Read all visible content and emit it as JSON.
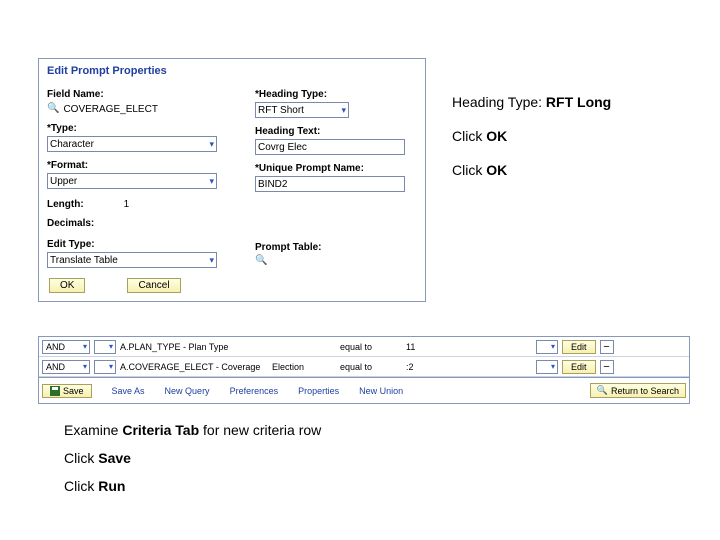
{
  "dialog": {
    "title": "Edit Prompt Properties",
    "left": {
      "fieldName_label": "Field Name:",
      "fieldName_val": "COVERAGE_ELECT",
      "type_label": "Type:",
      "type_val": "Character",
      "format_label": "Format:",
      "format_val": "Upper",
      "length_label": "Length:",
      "length_val": "1",
      "decimals_label": "Decimals:",
      "editType_label": "Edit Type:",
      "editType_val": "Translate Table"
    },
    "right": {
      "headingType_label": "Heading Type:",
      "headingType_val": "RFT Short",
      "headingText_label": "Heading Text:",
      "headingText_val": "Covrg Elec",
      "uniquePrompt_label": "Unique Prompt Name:",
      "uniquePrompt_val": "BIND2",
      "promptTable_label": "Prompt Table:"
    },
    "ok": "OK",
    "cancel": "Cancel"
  },
  "rightNotes": {
    "l1a": "Heading Type: ",
    "l1b": "RFT Long",
    "l2a": "Click ",
    "l2b": "OK",
    "l3a": "Click ",
    "l3b": "OK"
  },
  "grid": {
    "rows": [
      {
        "op": "AND",
        "expr": "A.PLAN_TYPE - Plan Type",
        "desc": "",
        "cond": "equal to",
        "val": "11",
        "edit": "Edit"
      },
      {
        "op": "AND",
        "expr": "A.COVERAGE_ELECT - Coverage",
        "desc": "Election",
        "cond": "equal to",
        "val": ":2",
        "edit": "Edit"
      }
    ],
    "bar": {
      "save": "Save",
      "saveAs": "Save As",
      "newQuery": "New Query",
      "prefs": "Preferences",
      "props": "Properties",
      "newUnion": "New Union",
      "return": "Return to Search"
    }
  },
  "bottomNotes": {
    "l1a": "Examine ",
    "l1b": "Criteria Tab ",
    "l1c": "for new criteria row",
    "l2a": "Click ",
    "l2b": "Save",
    "l3a": "Click ",
    "l3b": "Run"
  }
}
